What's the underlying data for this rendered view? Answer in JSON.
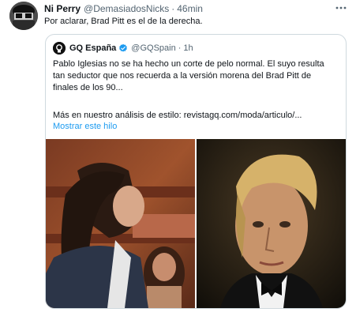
{
  "tweet": {
    "author": {
      "display_name": "Ni Perry",
      "handle": "@DemasiadosNicks",
      "separator": "·",
      "time": "46min"
    },
    "text": "Por aclarar, Brad Pitt es el de la derecha.",
    "more_icon": "more-horizontal-icon"
  },
  "quoted": {
    "author": {
      "display_name": "GQ España",
      "handle": "@GQSpain",
      "separator": "·",
      "time": "1h",
      "verified_icon": "verified-badge-icon"
    },
    "body_lines": [
      "Pablo Iglesias no se ha hecho un corte de pelo normal. El suyo resulta",
      "tan seductor que nos recuerda a la versión morena del Brad Pitt de",
      "finales de los 90..."
    ],
    "more_text": "Más en nuestro análisis de estilo: revistagq.com/moda/articulo/...",
    "show_thread": "Mostrar este hilo",
    "media": [
      {
        "description": "photo-left"
      },
      {
        "description": "photo-right"
      }
    ]
  },
  "colors": {
    "text": "#0f1419",
    "secondary": "#536471",
    "link": "#1d9bf0",
    "border": "#cfd9de"
  }
}
